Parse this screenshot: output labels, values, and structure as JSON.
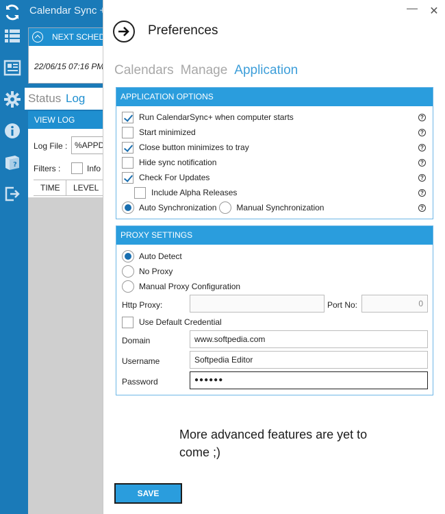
{
  "background_app": {
    "title": "Calendar Sync +",
    "schedule_header": "NEXT SCHEDULE",
    "schedule_value": "22/06/15 07:16 PM",
    "tabs": [
      "Status",
      "Log"
    ],
    "view_log_header": "VIEW LOG",
    "log_file_label": "Log File :",
    "log_file_value": "%APPDATA%",
    "filters_label": "Filters :",
    "info_label": "Info",
    "columns": [
      "TIME",
      "LEVEL"
    ]
  },
  "rail": {
    "icons": [
      "sync-icon",
      "list-icon",
      "news-icon",
      "gear-icon",
      "info-icon",
      "help-book-icon",
      "exit-icon"
    ]
  },
  "preferences": {
    "title": "Preferences",
    "minimize_glyph": "—",
    "close_glyph": "✕",
    "tabs": [
      {
        "label": "Calendars",
        "active": false
      },
      {
        "label": "Manage",
        "active": false
      },
      {
        "label": "Application",
        "active": true
      }
    ],
    "app_options": {
      "header": "APPLICATION OPTIONS",
      "items": [
        {
          "label": "Run CalendarSync+ when computer starts",
          "checked": true
        },
        {
          "label": "Start minimized",
          "checked": false
        },
        {
          "label": "Close button minimizes to tray",
          "checked": true
        },
        {
          "label": "Hide sync notification",
          "checked": false
        },
        {
          "label": "Check For Updates",
          "checked": true
        },
        {
          "label": "Include Alpha Releases",
          "checked": false
        }
      ],
      "sync_modes": [
        {
          "label": "Auto Synchronization",
          "selected": true
        },
        {
          "label": "Manual Synchronization",
          "selected": false
        }
      ],
      "help_glyph": "?"
    },
    "proxy": {
      "header": "PROXY SETTINGS",
      "modes": [
        {
          "label": "Auto Detect",
          "selected": true
        },
        {
          "label": "No Proxy",
          "selected": false
        },
        {
          "label": "Manual Proxy Configuration",
          "selected": false
        }
      ],
      "http_proxy_label": "Http Proxy:",
      "http_proxy_value": "",
      "port_label": "Port No:",
      "port_value": "0",
      "default_credential_label": "Use Default Credential",
      "default_credential_checked": false,
      "domain_label": "Domain",
      "domain_value": "www.softpedia.com",
      "username_label": "Username",
      "username_value": "Softpedia Editor",
      "password_label": "Password",
      "password_value": "●●●●●●"
    },
    "more_text": "More advanced features are yet to come ;)",
    "save_label": "SAVE"
  },
  "colors": {
    "accent": "#2a9ddd",
    "rail": "#1a7ab8",
    "tab_active": "#3d9ed9",
    "tab_inactive": "#a8a8a8",
    "check": "#1a6fb0"
  }
}
